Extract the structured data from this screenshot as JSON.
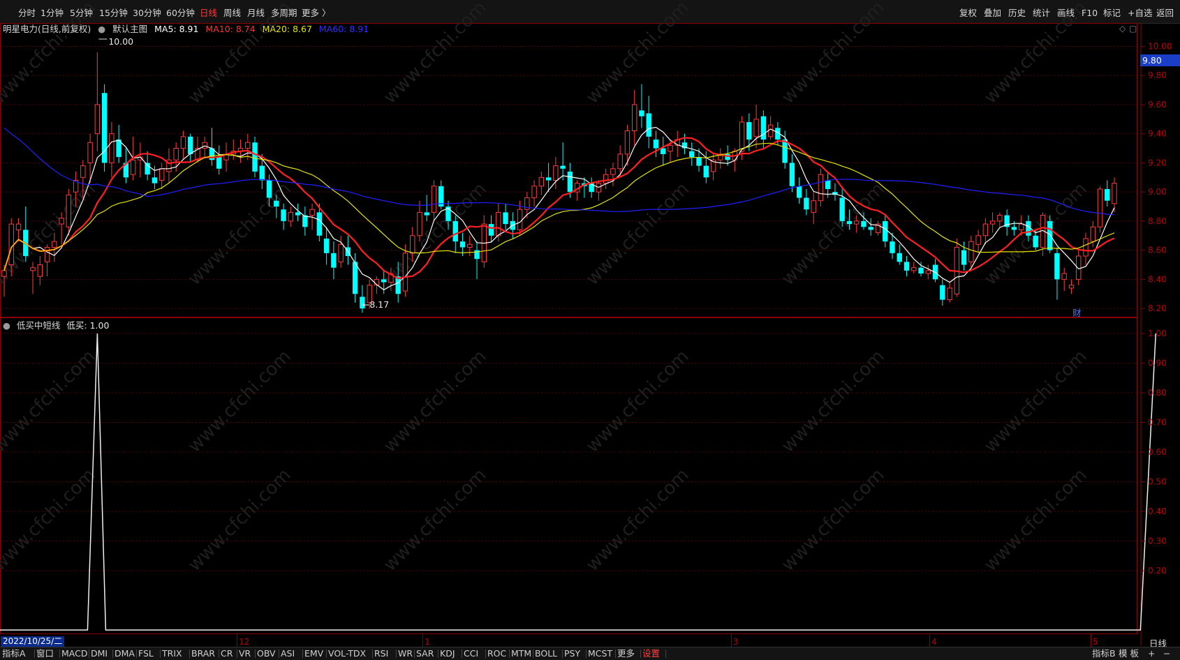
{
  "toolbar": {
    "periods": [
      "分时",
      "1分钟",
      "5分钟",
      "15分钟",
      "30分钟",
      "60分钟",
      "日线",
      "周线",
      "月线",
      "多周期",
      "更多 〉"
    ],
    "active_period": "日线",
    "right_buttons": [
      "复权",
      "叠加",
      "历史",
      "统计",
      "画线",
      "F10",
      "标记",
      "+自选",
      "返回"
    ]
  },
  "main_panel": {
    "title": "明星电力(日线,前复权)",
    "template": "默认主图",
    "ma5": "MA5: 8.91",
    "ma10": "MA10: 8.74",
    "ma20": "MA20: 8.67",
    "ma60": "MA60: 8.91",
    "high_annotation": "10.00",
    "low_annotation": "8.17",
    "finance_marker": "财",
    "current_price_tag": "9.80",
    "y_ticks": [
      "10.00",
      "9.80",
      "9.60",
      "9.40",
      "9.20",
      "9.00",
      "8.80",
      "8.60",
      "8.40",
      "8.20"
    ]
  },
  "indicator_panel": {
    "title": "低买中短线",
    "value": "低买: 1.00",
    "y_ticks": [
      "1.00",
      "0.90",
      "0.80",
      "0.70",
      "0.60",
      "0.50",
      "0.40",
      "0.30",
      "0.20"
    ]
  },
  "x_axis": {
    "cursor_date": "2022/10/25/二",
    "month_labels": [
      "12",
      "1",
      "3",
      "4",
      "5"
    ],
    "period_label": "日线"
  },
  "bottom_tabs": {
    "left": [
      "指标A",
      "窗口",
      "MACD",
      "DMI",
      "DMA",
      "FSL",
      "TRIX",
      "BRAR",
      "CR",
      "VR",
      "OBV",
      "ASI",
      "EMV",
      "VOL-TDX",
      "RSI",
      "WR",
      "SAR",
      "KDJ",
      "CCI",
      "ROC",
      "MTM",
      "BOLL",
      "PSY",
      "MCST",
      "更多",
      "设置"
    ],
    "right": [
      "指标B",
      "模 板",
      "+",
      "−"
    ]
  },
  "watermark": "www.cfchi.com",
  "colors": {
    "up": "#ff3c3c",
    "down": "#00ffff",
    "ma5": "#ffffff",
    "ma10": "#ff2020",
    "ma20": "#e6e600",
    "ma60": "#2020ff",
    "grid": "#8b0000",
    "active": "#ff3c3c"
  },
  "chart_data": [
    {
      "type": "candlestick",
      "title": "明星电力(日线,前复权)",
      "ylim": [
        8.12,
        10.1
      ],
      "x_first_date": "2022/10/25",
      "x_month_labels": [
        "12",
        "1",
        "3",
        "4",
        "5"
      ],
      "series_ohlc": [
        [
          8.42,
          8.5,
          8.28,
          8.46
        ],
        [
          8.5,
          8.82,
          8.42,
          8.78
        ],
        [
          8.74,
          8.82,
          8.66,
          8.78
        ],
        [
          8.74,
          8.9,
          8.52,
          8.56
        ],
        [
          8.46,
          8.52,
          8.3,
          8.48
        ],
        [
          8.42,
          8.56,
          8.36,
          8.5
        ],
        [
          8.52,
          8.64,
          8.42,
          8.62
        ],
        [
          8.62,
          8.72,
          8.52,
          8.66
        ],
        [
          8.78,
          8.86,
          8.64,
          8.82
        ],
        [
          8.76,
          9.02,
          8.7,
          8.98
        ],
        [
          9.0,
          9.14,
          8.9,
          9.08
        ],
        [
          9.1,
          9.22,
          8.96,
          9.18
        ],
        [
          9.2,
          9.4,
          9.06,
          9.34
        ],
        [
          9.4,
          9.96,
          9.28,
          9.6
        ],
        [
          9.68,
          9.74,
          9.14,
          9.2
        ],
        [
          9.2,
          9.48,
          9.1,
          9.4
        ],
        [
          9.36,
          9.46,
          9.2,
          9.24
        ],
        [
          9.2,
          9.3,
          9.06,
          9.1
        ],
        [
          9.12,
          9.38,
          9.08,
          9.22
        ],
        [
          9.22,
          9.34,
          9.1,
          9.24
        ],
        [
          9.2,
          9.28,
          9.08,
          9.12
        ],
        [
          9.1,
          9.18,
          9.02,
          9.06
        ],
        [
          9.08,
          9.2,
          9.02,
          9.16
        ],
        [
          9.14,
          9.3,
          9.06,
          9.22
        ],
        [
          9.22,
          9.34,
          9.14,
          9.3
        ],
        [
          9.3,
          9.42,
          9.22,
          9.38
        ],
        [
          9.38,
          9.4,
          9.2,
          9.26
        ],
        [
          9.22,
          9.38,
          9.2,
          9.3
        ],
        [
          9.3,
          9.38,
          9.24,
          9.34
        ],
        [
          9.3,
          9.44,
          9.18,
          9.22
        ],
        [
          9.24,
          9.32,
          9.12,
          9.16
        ],
        [
          9.22,
          9.34,
          9.14,
          9.26
        ],
        [
          9.26,
          9.36,
          9.22,
          9.28
        ],
        [
          9.28,
          9.36,
          9.2,
          9.3
        ],
        [
          9.3,
          9.4,
          9.22,
          9.34
        ],
        [
          9.34,
          9.38,
          9.1,
          9.14
        ],
        [
          9.18,
          9.26,
          9.02,
          9.08
        ],
        [
          9.08,
          9.12,
          8.9,
          8.96
        ],
        [
          8.94,
          8.98,
          8.82,
          8.9
        ],
        [
          8.88,
          8.92,
          8.74,
          8.8
        ],
        [
          8.8,
          8.9,
          8.76,
          8.86
        ],
        [
          8.86,
          8.92,
          8.8,
          8.84
        ],
        [
          8.84,
          8.9,
          8.7,
          8.76
        ],
        [
          8.84,
          8.92,
          8.74,
          8.88
        ],
        [
          8.86,
          8.92,
          8.66,
          8.7
        ],
        [
          8.68,
          8.76,
          8.5,
          8.58
        ],
        [
          8.58,
          8.66,
          8.4,
          8.48
        ],
        [
          8.52,
          8.7,
          8.48,
          8.64
        ],
        [
          8.62,
          8.7,
          8.5,
          8.56
        ],
        [
          8.52,
          8.58,
          8.24,
          8.3
        ],
        [
          8.28,
          8.36,
          8.17,
          8.2
        ],
        [
          8.24,
          8.4,
          8.2,
          8.36
        ],
        [
          8.36,
          8.42,
          8.3,
          8.4
        ],
        [
          8.4,
          8.46,
          8.3,
          8.38
        ],
        [
          8.38,
          8.48,
          8.32,
          8.44
        ],
        [
          8.42,
          8.52,
          8.24,
          8.3
        ],
        [
          8.32,
          8.64,
          8.28,
          8.58
        ],
        [
          8.58,
          8.76,
          8.52,
          8.7
        ],
        [
          8.7,
          8.94,
          8.66,
          8.86
        ],
        [
          8.86,
          8.98,
          8.8,
          8.84
        ],
        [
          8.86,
          9.08,
          8.8,
          9.04
        ],
        [
          9.04,
          9.08,
          8.88,
          8.9
        ],
        [
          8.9,
          8.94,
          8.74,
          8.8
        ],
        [
          8.8,
          8.84,
          8.58,
          8.66
        ],
        [
          8.66,
          8.72,
          8.56,
          8.62
        ],
        [
          8.62,
          8.7,
          8.56,
          8.64
        ],
        [
          8.6,
          8.66,
          8.4,
          8.54
        ],
        [
          8.52,
          8.84,
          8.48,
          8.78
        ],
        [
          8.78,
          8.84,
          8.66,
          8.7
        ],
        [
          8.7,
          8.92,
          8.66,
          8.86
        ],
        [
          8.86,
          8.92,
          8.74,
          8.78
        ],
        [
          8.8,
          8.86,
          8.68,
          8.74
        ],
        [
          8.74,
          8.94,
          8.7,
          8.88
        ],
        [
          8.88,
          9.0,
          8.82,
          8.96
        ],
        [
          8.96,
          9.08,
          8.9,
          9.04
        ],
        [
          9.04,
          9.14,
          8.98,
          9.1
        ],
        [
          9.1,
          9.2,
          9.0,
          9.08
        ],
        [
          9.08,
          9.24,
          9.02,
          9.18
        ],
        [
          9.18,
          9.34,
          9.08,
          9.16
        ],
        [
          9.14,
          9.2,
          8.96,
          9.0
        ],
        [
          9.0,
          9.08,
          8.94,
          9.06
        ],
        [
          9.06,
          9.1,
          8.96,
          9.04
        ],
        [
          9.06,
          9.1,
          8.96,
          9.0
        ],
        [
          9.0,
          9.08,
          8.94,
          9.06
        ],
        [
          9.06,
          9.16,
          9.02,
          9.12
        ],
        [
          9.12,
          9.2,
          9.04,
          9.16
        ],
        [
          9.16,
          9.32,
          9.1,
          9.26
        ],
        [
          9.26,
          9.46,
          9.18,
          9.42
        ],
        [
          9.42,
          9.7,
          9.32,
          9.6
        ],
        [
          9.56,
          9.74,
          9.44,
          9.52
        ],
        [
          9.54,
          9.66,
          9.3,
          9.38
        ],
        [
          9.36,
          9.42,
          9.24,
          9.3
        ],
        [
          9.3,
          9.38,
          9.18,
          9.26
        ],
        [
          9.28,
          9.36,
          9.2,
          9.32
        ],
        [
          9.32,
          9.42,
          9.24,
          9.36
        ],
        [
          9.34,
          9.4,
          9.26,
          9.3
        ],
        [
          9.28,
          9.34,
          9.18,
          9.24
        ],
        [
          9.24,
          9.3,
          9.14,
          9.18
        ],
        [
          9.18,
          9.28,
          9.06,
          9.1
        ],
        [
          9.14,
          9.26,
          9.08,
          9.22
        ],
        [
          9.22,
          9.3,
          9.16,
          9.26
        ],
        [
          9.26,
          9.32,
          9.18,
          9.22
        ],
        [
          9.22,
          9.3,
          9.14,
          9.28
        ],
        [
          9.28,
          9.52,
          9.22,
          9.48
        ],
        [
          9.48,
          9.54,
          9.28,
          9.36
        ],
        [
          9.38,
          9.6,
          9.3,
          9.5
        ],
        [
          9.52,
          9.56,
          9.3,
          9.36
        ],
        [
          9.38,
          9.52,
          9.36,
          9.46
        ],
        [
          9.44,
          9.48,
          9.32,
          9.36
        ],
        [
          9.36,
          9.42,
          9.16,
          9.2
        ],
        [
          9.2,
          9.26,
          9.0,
          9.04
        ],
        [
          9.04,
          9.1,
          8.92,
          8.96
        ],
        [
          8.96,
          9.02,
          8.84,
          8.88
        ],
        [
          8.86,
          9.0,
          8.78,
          8.94
        ],
        [
          8.94,
          9.16,
          8.9,
          9.12
        ],
        [
          9.08,
          9.14,
          8.96,
          9.02
        ],
        [
          9.0,
          9.06,
          8.94,
          8.98
        ],
        [
          8.96,
          9.02,
          8.76,
          8.8
        ],
        [
          8.8,
          8.88,
          8.74,
          8.78
        ],
        [
          8.78,
          8.84,
          8.72,
          8.8
        ],
        [
          8.8,
          8.86,
          8.74,
          8.76
        ],
        [
          8.76,
          8.82,
          8.7,
          8.74
        ],
        [
          8.72,
          8.8,
          8.7,
          8.78
        ],
        [
          8.8,
          8.84,
          8.62,
          8.66
        ],
        [
          8.66,
          8.72,
          8.54,
          8.58
        ],
        [
          8.58,
          8.64,
          8.5,
          8.52
        ],
        [
          8.52,
          8.56,
          8.42,
          8.46
        ],
        [
          8.46,
          8.52,
          8.44,
          8.48
        ],
        [
          8.48,
          8.52,
          8.42,
          8.44
        ],
        [
          8.44,
          8.5,
          8.4,
          8.46
        ],
        [
          8.5,
          8.54,
          8.38,
          8.4
        ],
        [
          8.36,
          8.4,
          8.22,
          8.26
        ],
        [
          8.26,
          8.38,
          8.24,
          8.34
        ],
        [
          8.3,
          8.68,
          8.28,
          8.62
        ],
        [
          8.6,
          8.66,
          8.46,
          8.5
        ],
        [
          8.52,
          8.7,
          8.48,
          8.66
        ],
        [
          8.64,
          8.74,
          8.58,
          8.7
        ],
        [
          8.7,
          8.82,
          8.64,
          8.78
        ],
        [
          8.78,
          8.86,
          8.72,
          8.8
        ],
        [
          8.8,
          8.86,
          8.76,
          8.84
        ],
        [
          8.84,
          8.88,
          8.7,
          8.76
        ],
        [
          8.76,
          8.8,
          8.7,
          8.74
        ],
        [
          8.74,
          8.84,
          8.7,
          8.78
        ],
        [
          8.8,
          8.84,
          8.66,
          8.7
        ],
        [
          8.7,
          8.74,
          8.6,
          8.62
        ],
        [
          8.62,
          8.86,
          8.56,
          8.84
        ],
        [
          8.8,
          8.84,
          8.58,
          8.6
        ],
        [
          8.58,
          8.62,
          8.26,
          8.4
        ],
        [
          8.4,
          8.48,
          8.32,
          8.44
        ],
        [
          8.34,
          8.4,
          8.3,
          8.36
        ],
        [
          8.4,
          8.6,
          8.36,
          8.56
        ],
        [
          8.56,
          8.72,
          8.5,
          8.68
        ],
        [
          8.66,
          8.8,
          8.62,
          8.76
        ],
        [
          8.76,
          9.04,
          8.72,
          9.02
        ],
        [
          9.02,
          9.08,
          8.9,
          8.94
        ],
        [
          8.92,
          9.1,
          8.86,
          9.06
        ]
      ]
    },
    {
      "type": "line",
      "title": "低买中短线",
      "ylim": [
        0,
        1.0
      ],
      "series": [
        {
          "name": "低买",
          "spikes": [
            {
              "bar": 13,
              "value": 1.0
            },
            {
              "bar": 160,
              "value": 1.0
            }
          ]
        }
      ]
    }
  ]
}
